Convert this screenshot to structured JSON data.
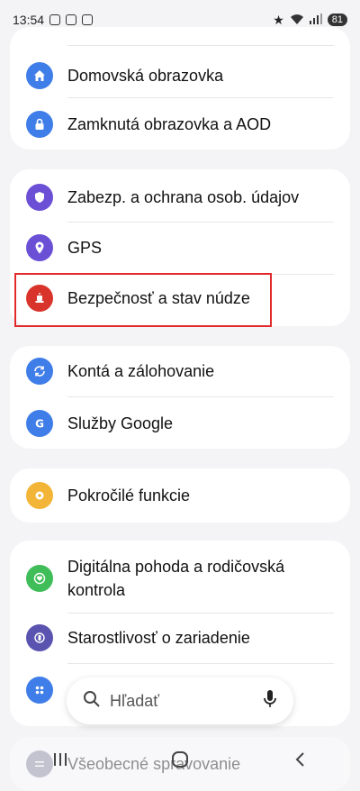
{
  "status": {
    "time": "13:54",
    "battery": "81"
  },
  "cards": [
    {
      "items": [
        {
          "label": "Domovská obrazovka",
          "icon": "home-icon",
          "color": "#3f7de8"
        },
        {
          "label": "Zamknutá obrazovka a AOD",
          "icon": "lock-icon",
          "color": "#3f7de8"
        }
      ]
    },
    {
      "items": [
        {
          "label": "Zabezp. a ochrana osob. údajov",
          "icon": "shield-icon",
          "color": "#6b50d6"
        },
        {
          "label": "GPS",
          "icon": "location-pin-icon",
          "color": "#6b50d6"
        },
        {
          "label": "Bezpečnosť a stav núdze",
          "icon": "emergency-icon",
          "color": "#d9342b"
        }
      ]
    },
    {
      "items": [
        {
          "label": "Kontá a zálohovanie",
          "icon": "sync-icon",
          "color": "#3f7de8"
        },
        {
          "label": "Služby Google",
          "icon": "google-icon",
          "color": "#3f7de8"
        }
      ]
    },
    {
      "items": [
        {
          "label": "Pokročilé funkcie",
          "icon": "gear-plus-icon",
          "color": "#f3b537"
        }
      ]
    },
    {
      "items": [
        {
          "label_line1": "Digitálna pohoda a rodičovská",
          "label_line2": "kontrola",
          "icon": "heart-circle-icon",
          "color": "#3fbd58"
        },
        {
          "label": "Starostlivosť o zariadenie",
          "icon": "device-care-icon",
          "color": "#5a53b0"
        }
      ]
    }
  ],
  "partial_bottom_label": "Všeobecné spravovanie",
  "search": {
    "placeholder": "Hľadať"
  }
}
